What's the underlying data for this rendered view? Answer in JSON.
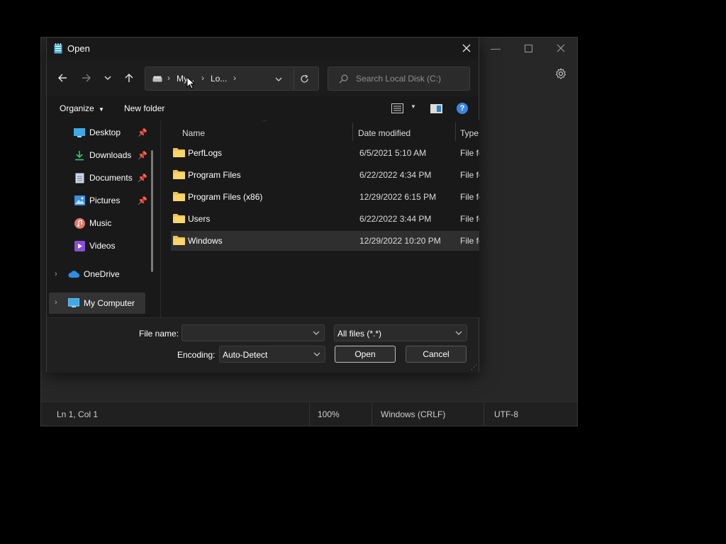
{
  "notepad": {
    "status": {
      "position": "Ln 1, Col 1",
      "zoom": "100%",
      "line_ending": "Windows (CRLF)",
      "encoding": "UTF-8"
    }
  },
  "dialog": {
    "title": "Open",
    "address": {
      "parts": [
        "My...",
        "Lo..."
      ]
    },
    "search_placeholder": "Search Local Disk (C:)",
    "toolbar": {
      "organize": "Organize",
      "new_folder": "New folder"
    },
    "nav": {
      "quick_access": [
        {
          "label": "Desktop",
          "icon": "desktop-icon",
          "pinned": true
        },
        {
          "label": "Downloads",
          "icon": "downloads-icon",
          "pinned": true
        },
        {
          "label": "Documents",
          "icon": "documents-icon",
          "pinned": true
        },
        {
          "label": "Pictures",
          "icon": "pictures-icon",
          "pinned": true
        },
        {
          "label": "Music",
          "icon": "music-icon",
          "pinned": false
        },
        {
          "label": "Videos",
          "icon": "videos-icon",
          "pinned": false
        }
      ],
      "onedrive": "OneDrive",
      "my_computer": "My Computer"
    },
    "columns": {
      "name": "Name",
      "date": "Date modified",
      "type": "Type"
    },
    "files": [
      {
        "name": "PerfLogs",
        "date": "6/5/2021 5:10 AM",
        "type": "File fo"
      },
      {
        "name": "Program Files",
        "date": "6/22/2022 4:34 PM",
        "type": "File fo"
      },
      {
        "name": "Program Files (x86)",
        "date": "12/29/2022 6:15 PM",
        "type": "File fo"
      },
      {
        "name": "Users",
        "date": "6/22/2022 3:44 PM",
        "type": "File fo"
      },
      {
        "name": "Windows",
        "date": "12/29/2022 10:20 PM",
        "type": "File fo",
        "selected": true
      }
    ],
    "bottom": {
      "filename_label": "File name:",
      "filename_value": "",
      "filter_value": "All files  (*.*)",
      "encoding_label": "Encoding:",
      "encoding_value": "Auto-Detect",
      "open_button": "Open",
      "cancel_button": "Cancel"
    }
  },
  "colors": {
    "folder": "#f1c54b",
    "accent_blue": "#2f7fd6",
    "help_blue": "#3a86e0"
  }
}
